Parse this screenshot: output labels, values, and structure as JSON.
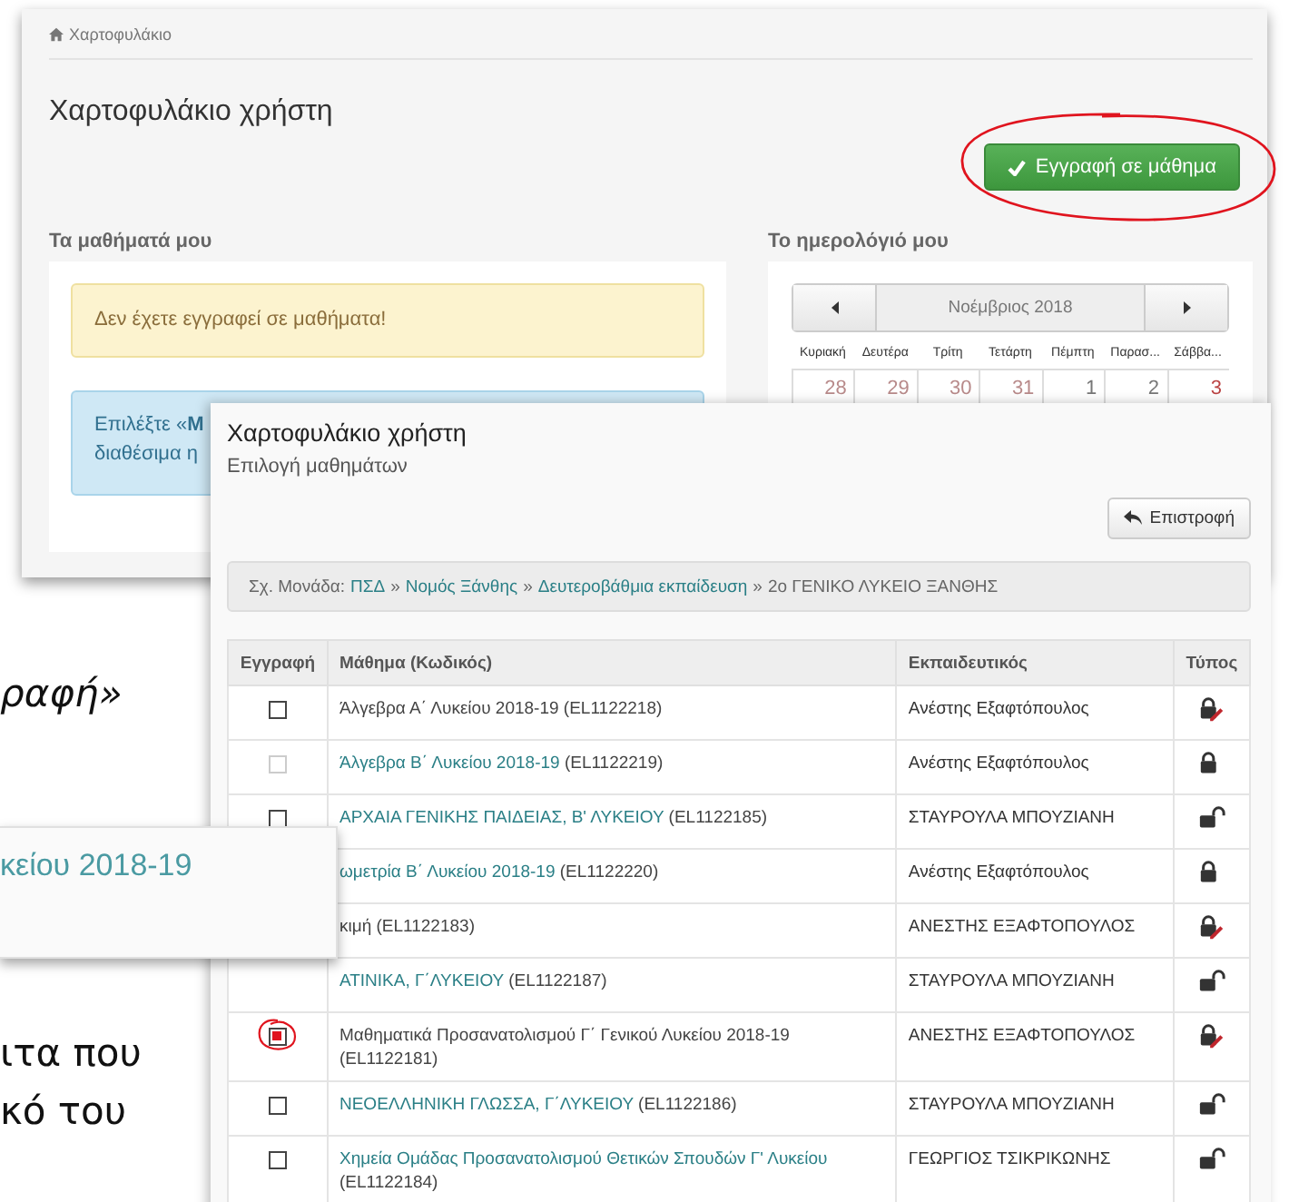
{
  "document_text": [
    {
      "text": "ραφή»",
      "italic": true
    },
    {
      "text": "ιτα που",
      "italic": false
    },
    {
      "text": "κό του",
      "italic": false
    }
  ],
  "portfolio_page": {
    "breadcrumb": "Χαρτοφυλάκιο",
    "title": "Χαρτοφυλάκιο χρήστη",
    "enroll_button": {
      "label": "Εγγραφή σε μάθημα",
      "highlighted": true
    },
    "my_courses": {
      "heading": "Τα μαθήματά μου",
      "warning": "Δεν έχετε εγγραφεί σε μαθήματα!",
      "info_lines": [
        "Επιλέξτε «**Μ**",
        "διαθέσιμα η"
      ]
    },
    "calendar": {
      "heading": "Το ημερολόγιό μου",
      "month": "Νοέμβριος 2018",
      "weekdays": [
        "Κυριακή",
        "Δευτέρα",
        "Τρίτη",
        "Τετάρτη",
        "Πέμπτη",
        "Παρασ...",
        "Σάββα..."
      ],
      "dates": [
        {
          "day": "28",
          "kind": "outside"
        },
        {
          "day": "29",
          "kind": "outside"
        },
        {
          "day": "30",
          "kind": "outside"
        },
        {
          "day": "31",
          "kind": "outside"
        },
        {
          "day": "1",
          "kind": "day"
        },
        {
          "day": "2",
          "kind": "day"
        },
        {
          "day": "3",
          "kind": "saturday"
        }
      ]
    }
  },
  "course_selection": {
    "title": "Χαρτοφυλάκιο χρήστη",
    "subtitle": "Επιλογή μαθημάτων",
    "back_button": "Επιστροφή",
    "breadcrumb": {
      "label": "Σχ. Μονάδα:",
      "separator": "»",
      "items": [
        {
          "text": "ΠΣΔ",
          "link": true
        },
        {
          "text": "Νομός Ξάνθης",
          "link": true
        },
        {
          "text": "Δευτεροβάθμια εκπαίδευση",
          "link": true
        },
        {
          "text": "2ο ΓΕΝΙΚΟ ΛΥΚΕΙΟ ΞΑΝΘΗΣ",
          "link": false
        }
      ]
    },
    "table": {
      "columns": [
        "Εγγραφή",
        "Μάθημα (Κωδικός)",
        "Εκπαιδευτικός",
        "Τύπος"
      ],
      "rows": [
        {
          "checkbox": {
            "checked": false,
            "disabled": false,
            "highlighted": false
          },
          "course": "Άλγεβρα Α΄ Λυκείου 2018-19",
          "course_link": false,
          "code": "(EL1122218)",
          "teacher": "Ανέστης Εξαφτόπουλος",
          "type_icon": {
            "kind": "lock_edit"
          }
        },
        {
          "checkbox": {
            "checked": false,
            "disabled": true,
            "highlighted": false
          },
          "course": "Άλγεβρα Β΄ Λυκείου 2018-19",
          "course_link": true,
          "code": "(EL1122219)",
          "teacher": "Ανέστης Εξαφτόπουλος",
          "type_icon": {
            "kind": "lock"
          }
        },
        {
          "checkbox": {
            "checked": false,
            "disabled": false,
            "highlighted": false
          },
          "course": "ΑΡΧΑΙΑ ΓΕΝΙΚΗΣ ΠΑΙΔΕΙΑΣ, Β' ΛΥΚΕΙΟΥ",
          "course_link": true,
          "code": "(EL1122185)",
          "teacher": "ΣΤΑΥΡΟΥΛΑ ΜΠΟΥΖΙΑΝΗ",
          "type_icon": {
            "kind": "unlock"
          }
        },
        {
          "course": "ωμετρία Β΄ Λυκείου 2018-19",
          "course_link": true,
          "code": "(EL1122220)",
          "teacher": "Ανέστης Εξαφτόπουλος",
          "type_icon": {
            "kind": "lock"
          }
        },
        {
          "course": "κιμή",
          "course_link": false,
          "code": "(EL1122183)",
          "teacher": "ΑΝΕΣΤΗΣ ΕΞΑΦΤΟΠΟΥΛΟΣ",
          "type_icon": {
            "kind": "lock_edit"
          }
        },
        {
          "course": "ΑΤΙΝΙΚΑ, Γ΄ΛΥΚΕΙΟΥ",
          "course_link": true,
          "code": "(EL1122187)",
          "teacher": "ΣΤΑΥΡΟΥΛΑ ΜΠΟΥΖΙΑΝΗ",
          "type_icon": {
            "kind": "unlock"
          }
        },
        {
          "checkbox": {
            "checked": true,
            "disabled": false,
            "highlighted": true
          },
          "course": "Μαθηματικά Προσανατολισμού Γ΄ Γενικού Λυκείου 2018-19",
          "course_link": false,
          "code": "(EL1122181)",
          "teacher": "ΑΝΕΣΤΗΣ ΕΞΑΦΤΟΠΟΥΛΟΣ",
          "type_icon": {
            "kind": "lock_edit"
          }
        },
        {
          "checkbox": {
            "checked": false,
            "disabled": false,
            "highlighted": false
          },
          "course": "ΝΕΟΕΛΛΗΝΙΚΗ ΓΛΩΣΣΑ, Γ΄ΛΥΚΕΙΟΥ",
          "course_link": true,
          "code": "(EL1122186)",
          "teacher": "ΣΤΑΥΡΟΥΛΑ ΜΠΟΥΖΙΑΝΗ",
          "type_icon": {
            "kind": "unlock"
          }
        },
        {
          "checkbox": {
            "checked": false,
            "disabled": false,
            "highlighted": false
          },
          "course": "Χημεία Ομάδας Προσανατολισμού Θετικών Σπουδών Γ' Λυκείου",
          "course_link": true,
          "code": "(EL1122184)",
          "teacher": "ΓΕΩΡΓΙΟΣ ΤΣΙΚΡΙΚΩΝΗΣ",
          "type_icon": {
            "kind": "unlock"
          }
        }
      ]
    }
  },
  "snippet": {
    "text": "κείου 2018-19"
  }
}
